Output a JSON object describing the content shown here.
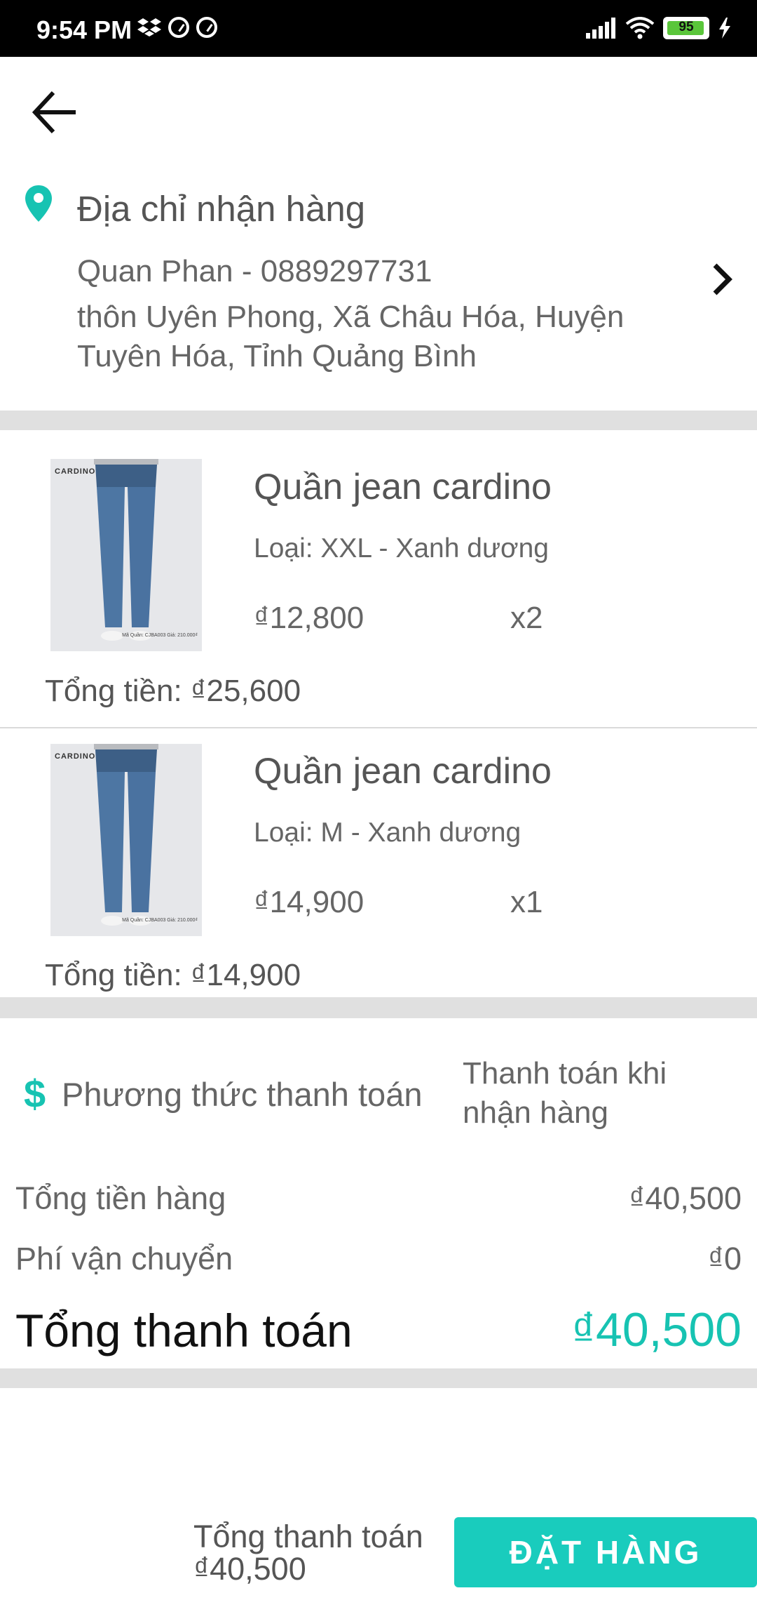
{
  "status_bar": {
    "time": "9:54 PM",
    "battery": "95",
    "icons": [
      "dropbox-icon",
      "sync-icon",
      "sync-icon",
      "signal-icon",
      "wifi-icon",
      "battery-icon",
      "charging-icon"
    ]
  },
  "address": {
    "title": "Địa chỉ nhận hàng",
    "name_phone": "Quan Phan - 0889297731",
    "line": "thôn Uyên Phong, Xã Châu Hóa, Huyện Tuyên Hóa, Tỉnh Quảng Bình"
  },
  "products": [
    {
      "name": "Quần jean cardino",
      "variant": "Loại: XXL - Xanh dương",
      "price": "₫12,800",
      "qty": "x2",
      "total": "Tổng tiền: ₫25,600",
      "thumb_brand": "CARDINO",
      "thumb_note": "Mã Quần: CJBA003 Giá: 210.000₫"
    },
    {
      "name": "Quần jean cardino",
      "variant": "Loại: M - Xanh dương",
      "price": "₫14,900",
      "qty": "x1",
      "total": "Tổng tiền: ₫14,900",
      "thumb_brand": "CARDINO",
      "thumb_note": "Mã Quần: CJBA003 Giá: 210.000₫"
    }
  ],
  "payment": {
    "label": "Phương thức thanh toán",
    "method": "Thanh toán khi nhận hàng"
  },
  "summary": {
    "goods_label": "Tổng tiền hàng",
    "goods_value": "₫40,500",
    "shipping_label": "Phí vận chuyển",
    "shipping_value": "₫0",
    "total_label": "Tổng thanh toán",
    "total_value": "₫40,500"
  },
  "bottom": {
    "total_label": "Tổng thanh toán",
    "total_value": "₫40,500",
    "order_button": "ĐẶT HÀNG"
  },
  "colors": {
    "accent": "#19ccbd",
    "separator": "#e0e0e0"
  }
}
